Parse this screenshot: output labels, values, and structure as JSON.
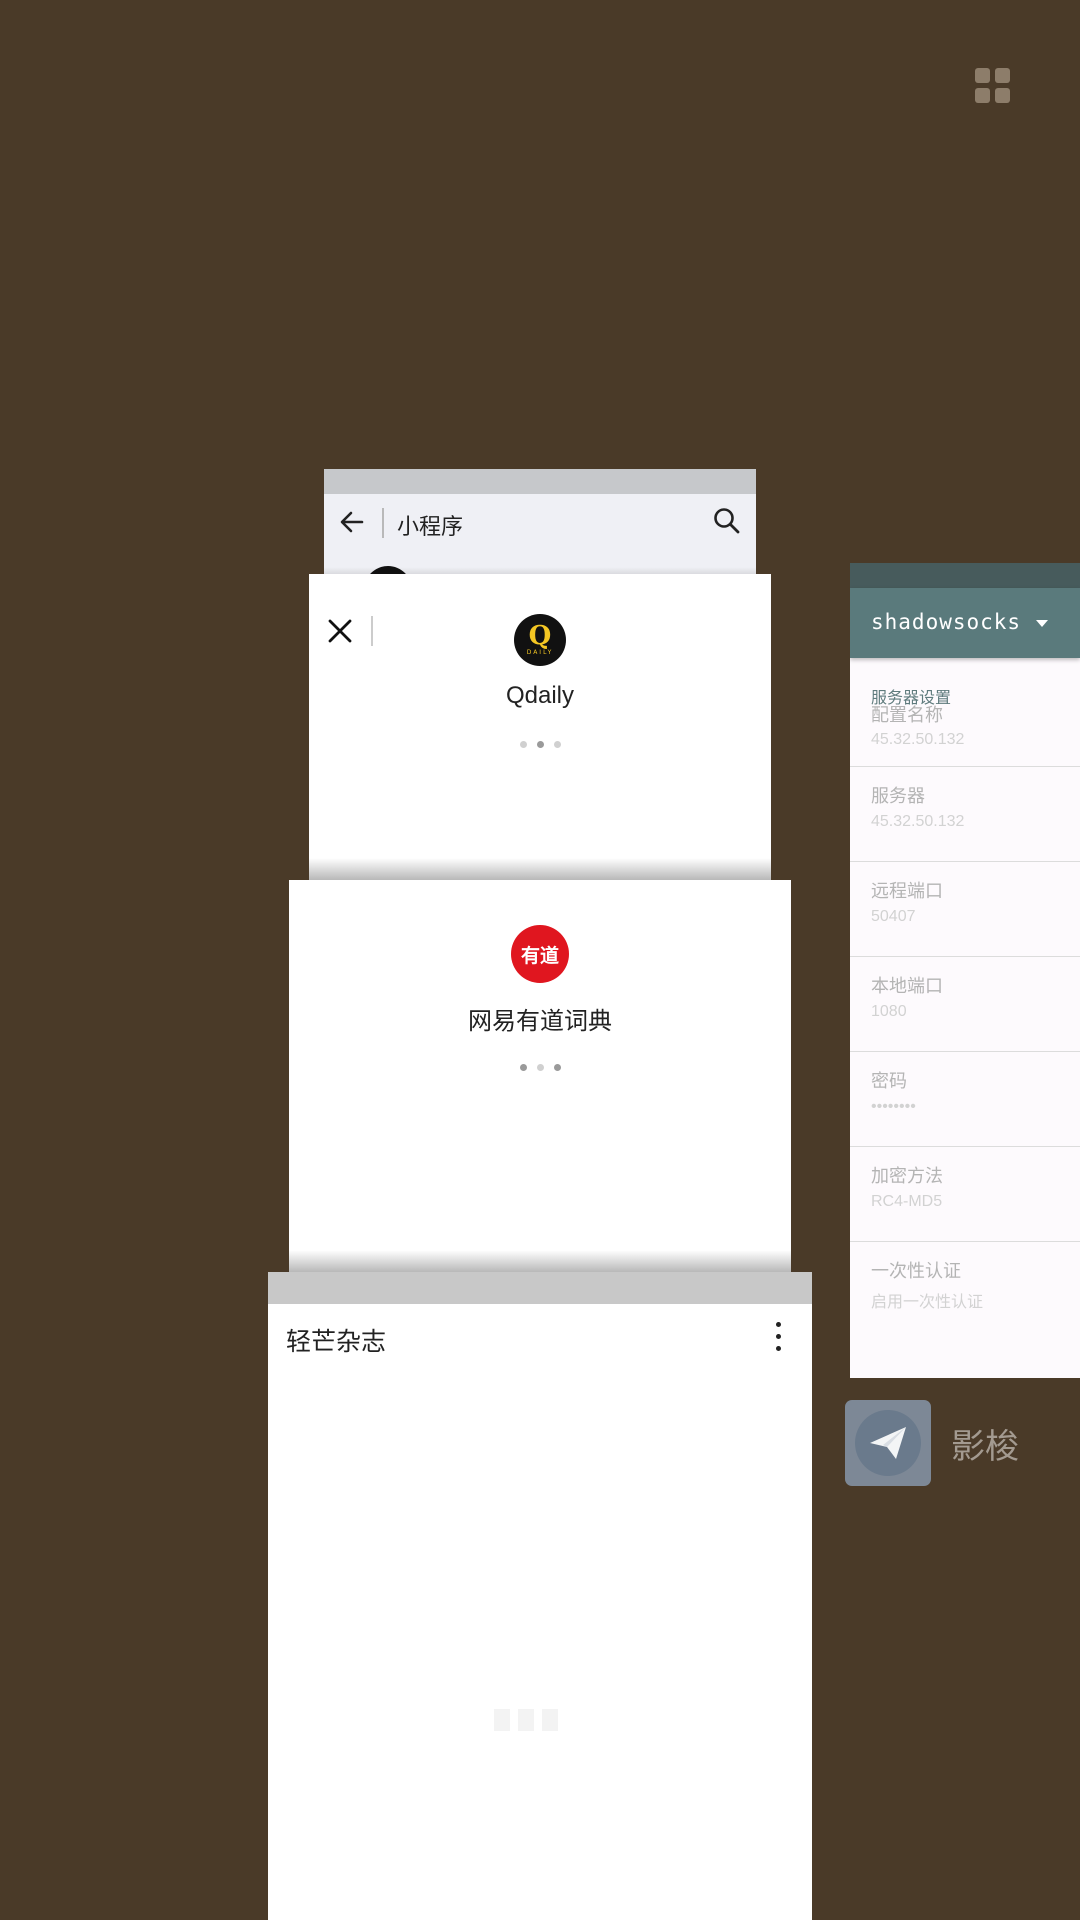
{
  "grid_icon": "grid-icon",
  "mini_program": {
    "title": "小程序",
    "back_icon": "arrow-left-icon",
    "search_icon": "search-icon"
  },
  "qdaily": {
    "name": "Qdaily",
    "logo_letter": "Q",
    "logo_sub": "DAILY",
    "close_icon": "close-icon",
    "active_dot": 1
  },
  "youdao": {
    "name": "网易有道词典",
    "logo_text": "有道",
    "active_dot": 0
  },
  "qingmang": {
    "title": "轻芒杂志",
    "menu_icon": "more-vertical-icon"
  },
  "shadowsocks": {
    "app_title": "shadowsocks",
    "section": "服务器设置",
    "items": [
      {
        "label": "配置名称",
        "value": "45.32.50.132"
      },
      {
        "label": "服务器",
        "value": "45.32.50.132"
      },
      {
        "label": "远程端口",
        "value": "50407"
      },
      {
        "label": "本地端口",
        "value": "1080"
      },
      {
        "label": "密码",
        "value": "••••••••"
      },
      {
        "label": "加密方法",
        "value": "RC4-MD5"
      },
      {
        "label": "一次性认证",
        "value": "启用一次性认证"
      }
    ]
  },
  "ss_app_label": "影梭",
  "colors": {
    "background": "#4a3a28",
    "ss_toolbar": "#5a7a7c",
    "youdao_red": "#e0161f",
    "qdaily_yellow": "#f3c623"
  }
}
